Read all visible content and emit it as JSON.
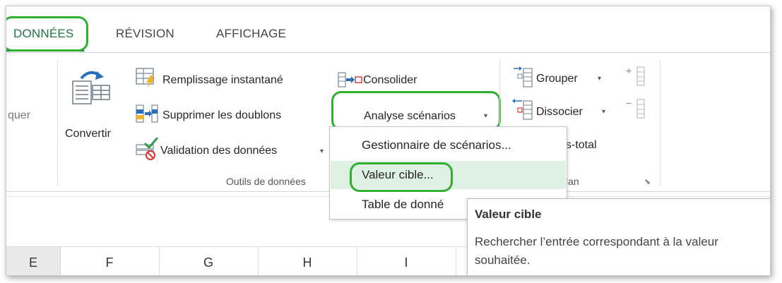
{
  "tabs": {
    "donnees": "DONNÉES",
    "revision": "RÉVISION",
    "affichage": "AFFICHAGE"
  },
  "ribbon": {
    "left_partial": "quer",
    "convertir": "Convertir",
    "remplissage": "Remplissage instantané",
    "supprimer": "Supprimer les doublons",
    "validation": "Validation des données",
    "consolider": "Consolider",
    "analyse": "Analyse scénarios",
    "grouper": "Grouper",
    "dissocier": "Dissocier",
    "sous_total_partial": "s-total",
    "group_outils": "Outils de données",
    "group_plan_partial": "lan"
  },
  "dropdown": {
    "items": [
      {
        "label": "Gestionnaire de scénarios..."
      },
      {
        "label": "Valeur cible..."
      },
      {
        "label": "Table de donné"
      }
    ]
  },
  "tooltip": {
    "title": "Valeur cible",
    "description": "Rechercher l’entrée correspondant à la valeur souhaitée."
  },
  "columns": [
    "E",
    "F",
    "G",
    "H",
    "I"
  ],
  "colors": {
    "accent": "#217346",
    "highlight_oval": "#2fb02f",
    "menu_hover": "#dff0e5"
  }
}
